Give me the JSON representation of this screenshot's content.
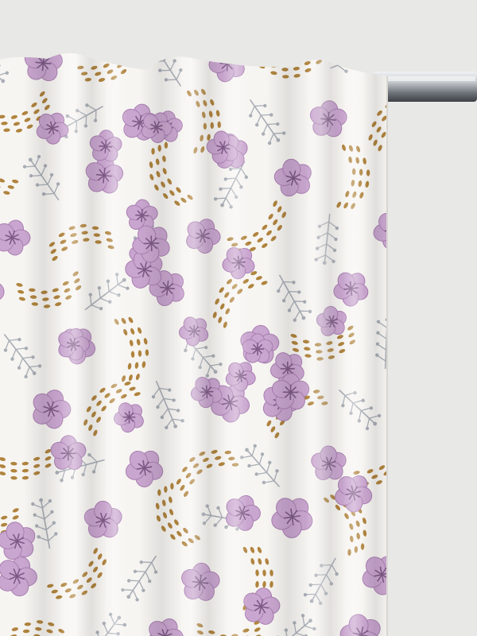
{
  "scene": {
    "subject": "floral-print-curtain-panel",
    "colors": {
      "backdrop": "#e8e8e6",
      "fabric": "#f7f5f2",
      "petal": "#c9a6cf",
      "petal_dark": "#a97fb2",
      "petal_center": "#7d5a86",
      "leaf_gold": "#b0843e",
      "sprig_grey": "#a9aeb6",
      "rod_light": "#dfe2e6",
      "rod_dark": "#6f747a"
    },
    "icons": {
      "flower": "five-petal-blossom",
      "seed_swirl": "gold-leaf-swirl",
      "sprig": "grey-berry-sprig",
      "rod": "metal-curtain-rod"
    }
  }
}
